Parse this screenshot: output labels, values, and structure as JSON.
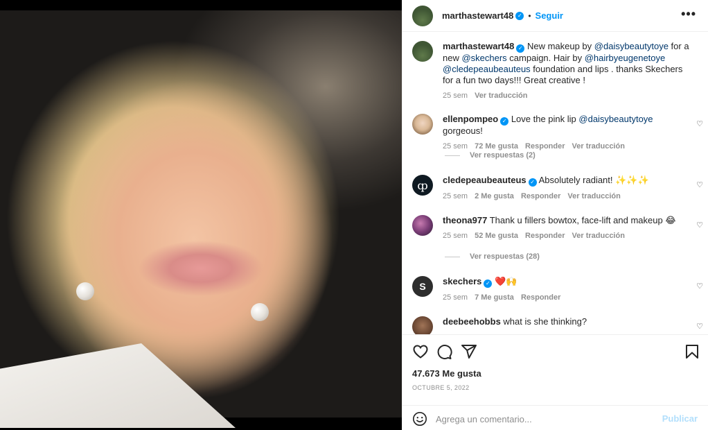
{
  "post": {
    "author": "marthastewart48",
    "dot": "•",
    "follow_label": "Seguir",
    "more_label": "•••",
    "caption_pre": "New makeup by ",
    "caption_m1": "@daisybeautytoye",
    "caption_mid1": " for a new ",
    "caption_m2": "@skechers",
    "caption_mid2": " campaign. Hair by ",
    "caption_m3": "@hairbyeugenetoye",
    "caption_m4": "@cledepeaubeauteus",
    "caption_post": " foundation and lips . thanks Skechers for a fun two days!!! Great creative !",
    "caption_time": "25 sem",
    "caption_translate": "Ver traducción"
  },
  "comments": [
    {
      "user": "ellenpompeo",
      "text_pre": "Love the pink lip ",
      "mention": "@daisybeautytoye",
      "text_post": " gorgeous!",
      "time": "25 sem",
      "likes": "72 Me gusta",
      "reply": "Responder",
      "translate": "Ver traducción",
      "replies": "Ver respuestas (2)"
    },
    {
      "user": "cledepeaubeauteus",
      "text": "Absolutely radiant! ✨✨✨",
      "time": "25 sem",
      "likes": "2 Me gusta",
      "reply": "Responder",
      "translate": "Ver traducción",
      "avatar_glyph": "ȹ"
    },
    {
      "user": "theona977",
      "text": "Thank u fillers bowtox, face-lift and makeup 😂",
      "time": "25 sem",
      "likes": "52 Me gusta",
      "reply": "Responder",
      "translate": "Ver traducción",
      "replies": "Ver respuestas (28)"
    },
    {
      "user": "skechers",
      "text": "❤️🙌",
      "time": "25 sem",
      "likes": "7 Me gusta",
      "reply": "Responder",
      "avatar_glyph": "S"
    },
    {
      "user": "deebeehobbs",
      "text": "what is she thinking?"
    }
  ],
  "footer": {
    "likes": "47.673 Me gusta",
    "date": "OCTUBRE 5, 2022",
    "comment_placeholder": "Agrega un comentario...",
    "publish_label": "Publicar"
  },
  "colors": {
    "accent": "#0095f6",
    "verified": "#0095f6",
    "mention": "#00376b",
    "muted": "#8e8e8e"
  },
  "icons": [
    "heart-icon",
    "comment-icon",
    "share-icon",
    "bookmark-icon",
    "emoji-icon",
    "verified-icon",
    "more-icon"
  ]
}
